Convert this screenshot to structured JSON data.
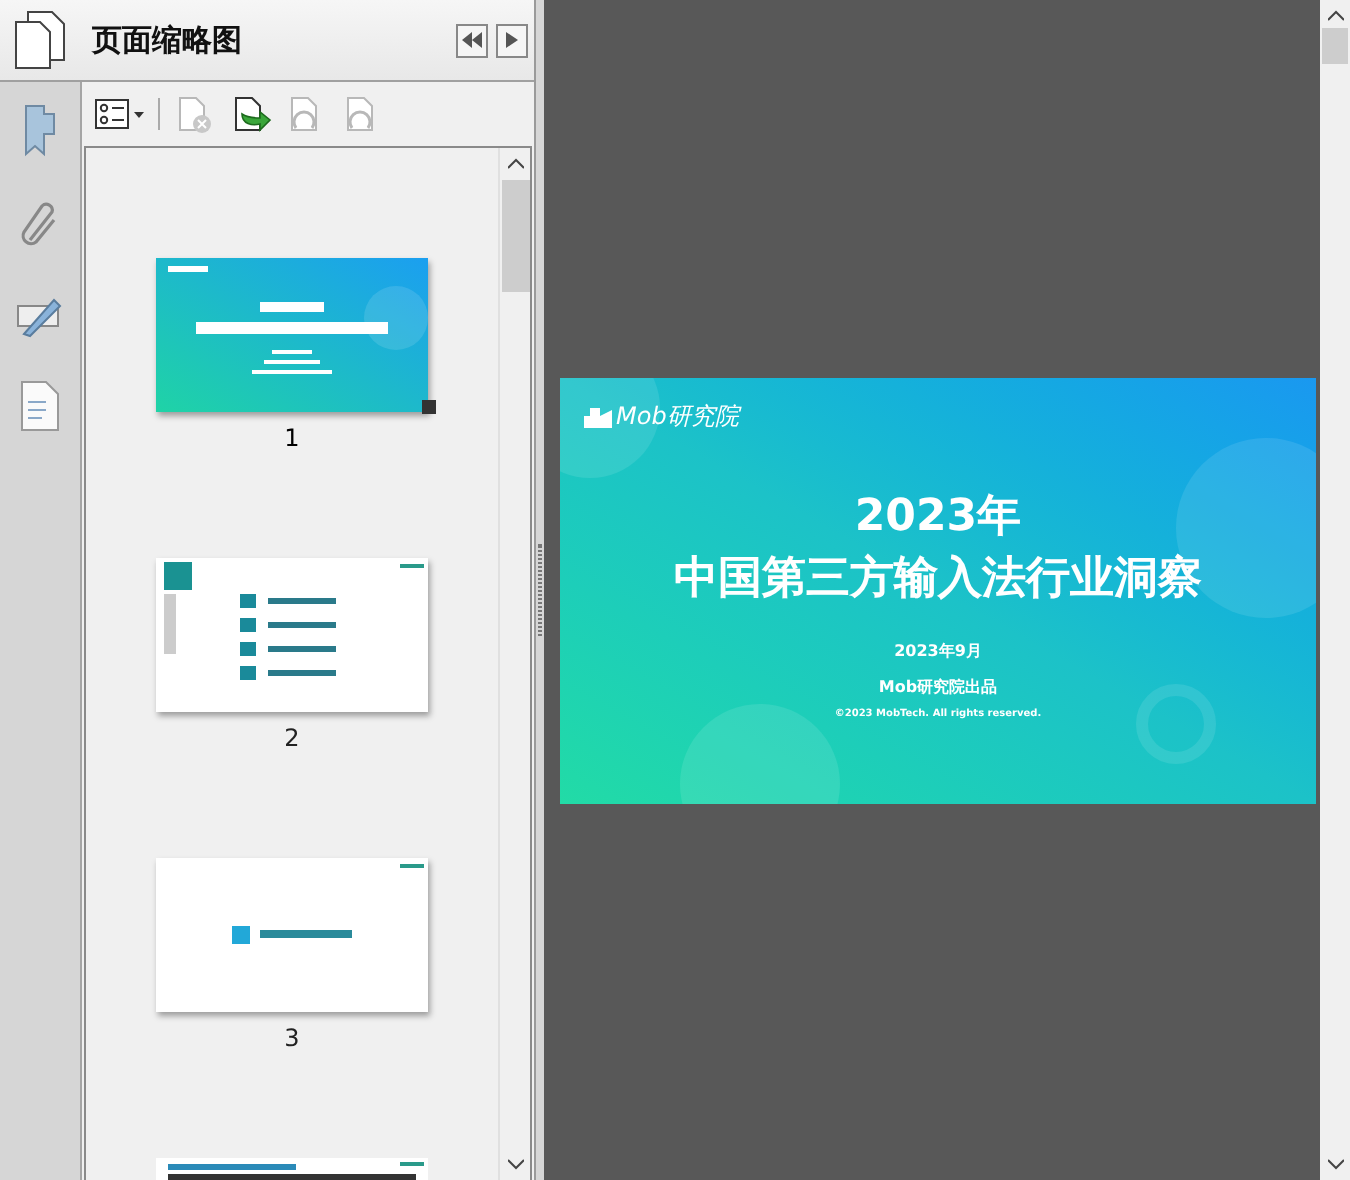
{
  "panel": {
    "title": "页面缩略图"
  },
  "toolbar": [
    {
      "kind": "options",
      "disabled": false
    },
    {
      "kind": "delete",
      "disabled": true
    },
    {
      "kind": "insert",
      "disabled": false
    },
    {
      "kind": "rotate_left",
      "disabled": true
    },
    {
      "kind": "rotate_right",
      "disabled": true
    }
  ],
  "thumbnails": [
    {
      "label": "1",
      "kind": "cover",
      "selected": true
    },
    {
      "label": "2",
      "kind": "contents",
      "selected": false
    },
    {
      "label": "3",
      "kind": "section",
      "selected": false
    },
    {
      "kind": "text"
    }
  ],
  "page": {
    "logo": "Mob研究院",
    "title_year": "2023年",
    "title": "中国第三方输入法行业洞察",
    "date": "2023年9月",
    "publisher": "Mob研究院出品",
    "copyright": "©2023 MobTech. All rights reserved."
  }
}
